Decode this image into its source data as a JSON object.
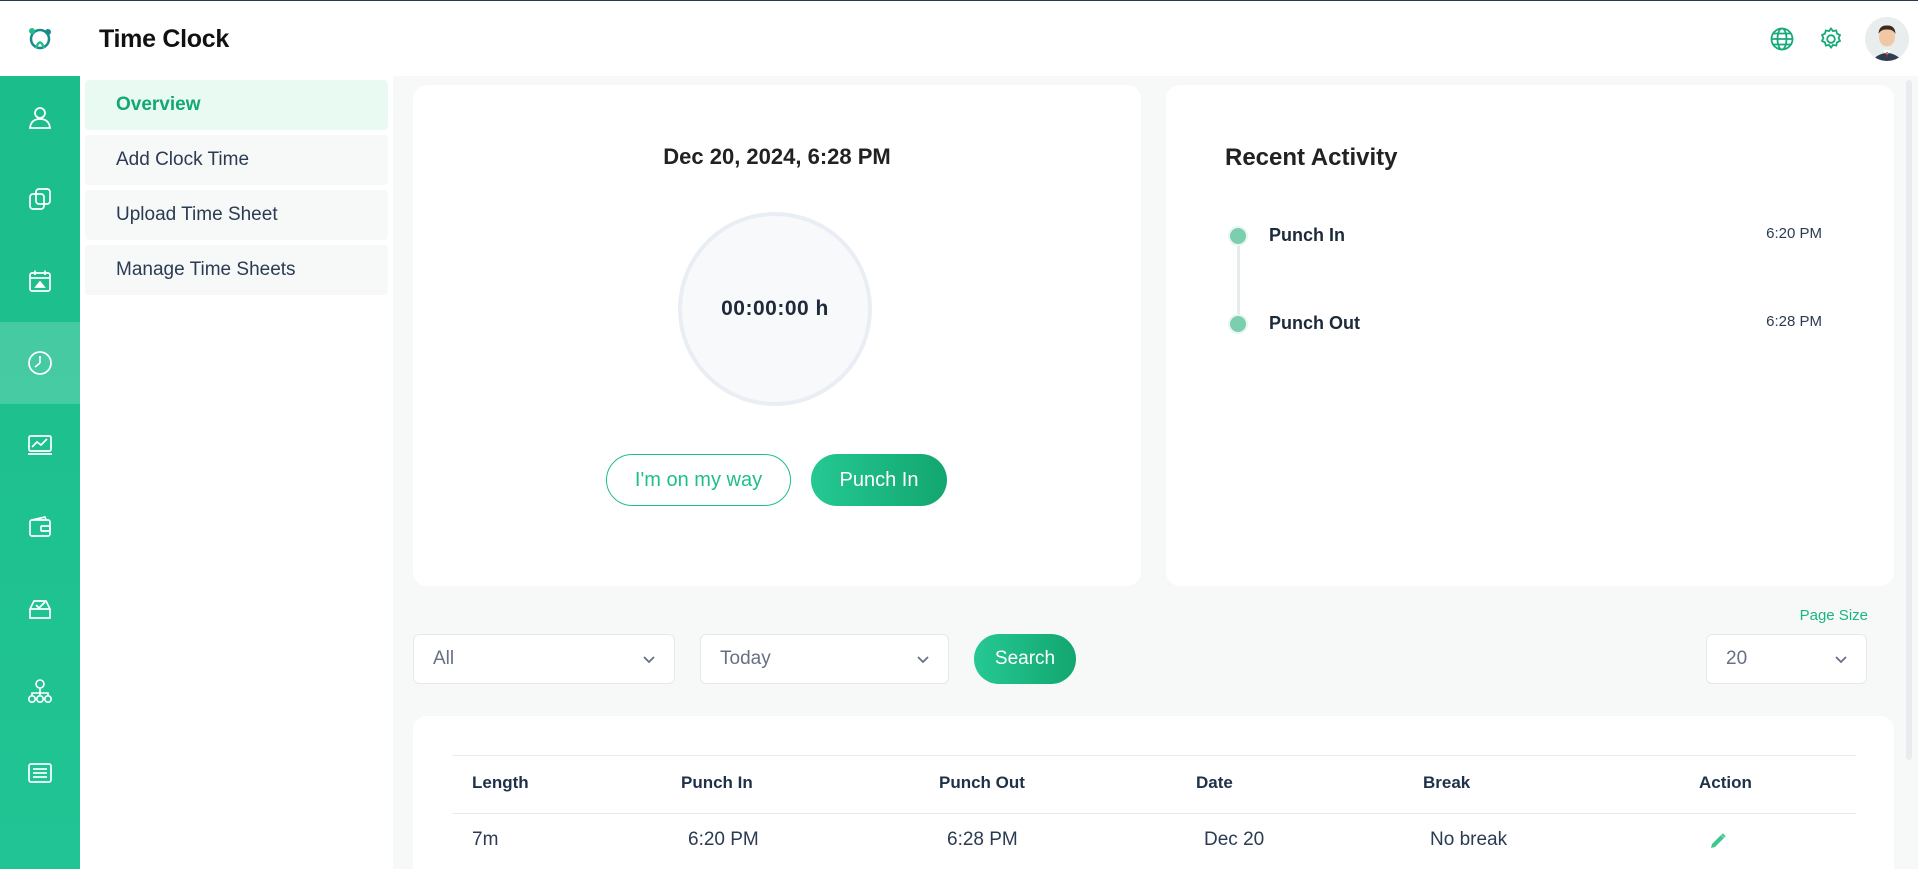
{
  "app": {
    "title": "Time Clock"
  },
  "topbar": {
    "icons": [
      "globe-icon",
      "gear-icon",
      "avatar"
    ]
  },
  "rail": {
    "items": [
      {
        "icon": "user-icon"
      },
      {
        "icon": "copy-icon"
      },
      {
        "icon": "calendar-icon"
      },
      {
        "icon": "clock-icon",
        "active": true
      },
      {
        "icon": "chart-icon"
      },
      {
        "icon": "wallet-icon"
      },
      {
        "icon": "inbox-check-icon"
      },
      {
        "icon": "org-chart-icon"
      },
      {
        "icon": "list-icon"
      }
    ]
  },
  "subnav": {
    "items": [
      {
        "label": "Overview",
        "active": true
      },
      {
        "label": "Add Clock Time"
      },
      {
        "label": "Upload Time Sheet"
      },
      {
        "label": "Manage Time Sheets"
      }
    ]
  },
  "clock": {
    "date": "Dec 20, 2024, 6:28 PM",
    "timer": "00:00:00 h",
    "on_my_way_label": "I'm on my way",
    "punch_in_label": "Punch In"
  },
  "activity": {
    "title": "Recent Activity",
    "events": [
      {
        "label": "Punch In",
        "time": "6:20 PM"
      },
      {
        "label": "Punch Out",
        "time": "6:28 PM"
      }
    ]
  },
  "filters": {
    "type_value": "All",
    "range_value": "Today",
    "search_label": "Search",
    "page_size_label": "Page Size",
    "page_size_value": "20"
  },
  "table": {
    "headers": [
      "Length",
      "Punch In",
      "Punch Out",
      "Date",
      "Break",
      "Action"
    ],
    "rows": [
      [
        "7m",
        "6:20 PM",
        "6:28 PM",
        "Dec 20",
        "No break"
      ]
    ]
  },
  "colors": {
    "accent": "#1fbf8c",
    "accent_dark": "#13a66f",
    "rail": "#1bbd8a"
  }
}
